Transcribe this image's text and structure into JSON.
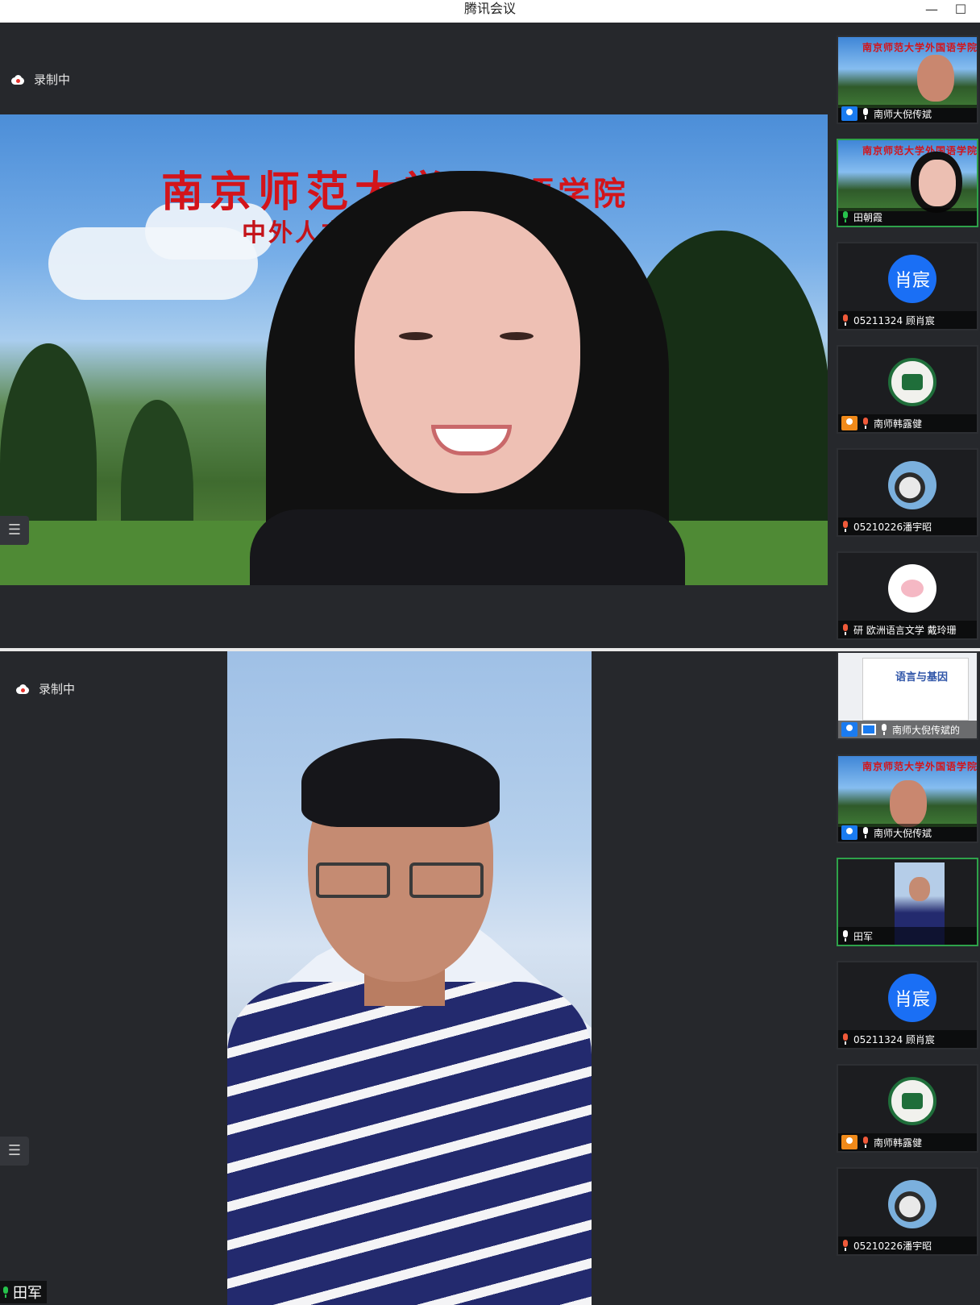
{
  "window": {
    "title": "腾讯会议",
    "minimize_glyph": "—",
    "maximize_glyph": "☐"
  },
  "top_panel": {
    "recording_label": "录制中",
    "main_video": {
      "banner_university": "南京师范大学",
      "banner_school": "外国语学院",
      "banner_subtitle": "中外人文纪"
    },
    "participants": [
      {
        "name": "南师大倪传斌",
        "host": true,
        "mic": "on",
        "avatar": "video-man"
      },
      {
        "name": "田朝霞",
        "host": false,
        "mic": "speaking",
        "avatar": "video-woman",
        "active": true
      },
      {
        "name": "05211324 顾肖宸",
        "host": false,
        "mic": "muted",
        "avatar": "text",
        "avatar_text": "肖宸"
      },
      {
        "name": "南师韩露健",
        "host": true,
        "mic": "muted",
        "avatar": "logo"
      },
      {
        "name": "05210226潘宇昭",
        "host": false,
        "mic": "muted",
        "avatar": "photo"
      },
      {
        "name": "研 欧洲语言文学 戴玲珊",
        "host": false,
        "mic": "muted",
        "avatar": "pig"
      }
    ]
  },
  "bottom_panel": {
    "recording_label": "录制中",
    "speaker_name": "田军",
    "list_button_glyph": "☰",
    "participants": [
      {
        "name": "南师大倪传斌的",
        "host": true,
        "sharing": true,
        "mic": "on",
        "avatar": "share-screen",
        "share_title": "语言与基因"
      },
      {
        "name": "南师大倪传斌",
        "host": true,
        "mic": "on",
        "avatar": "video-man"
      },
      {
        "name": "田军",
        "host": false,
        "mic": "on",
        "avatar": "video-small",
        "active": true
      },
      {
        "name": "05211324 顾肖宸",
        "host": false,
        "mic": "muted",
        "avatar": "text",
        "avatar_text": "肖宸"
      },
      {
        "name": "南师韩露健",
        "host": true,
        "mic": "muted",
        "avatar": "logo"
      },
      {
        "name": "05210226潘宇昭",
        "host": false,
        "mic": "muted",
        "avatar": "photo"
      }
    ]
  },
  "colors": {
    "panel_bg": "#26282c",
    "accent_blue": "#1a6ff5",
    "active_green": "#2ea24a",
    "banner_red": "#d3141a"
  }
}
